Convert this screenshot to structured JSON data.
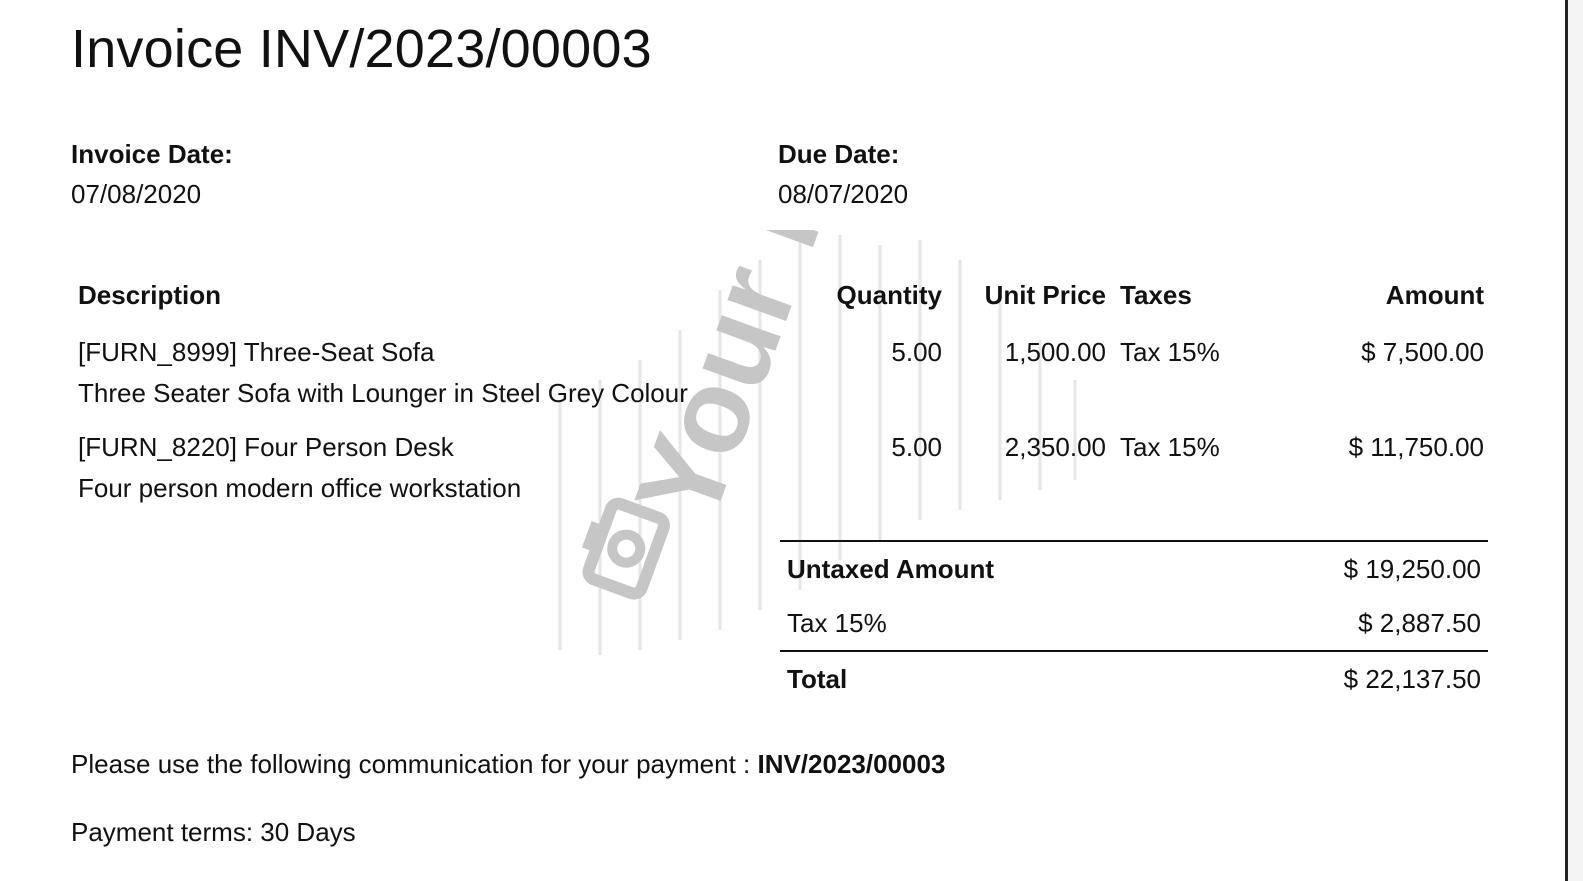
{
  "invoice": {
    "title": "Invoice INV/2023/00003",
    "invoice_date_label": "Invoice Date:",
    "invoice_date": "07/08/2020",
    "due_date_label": "Due Date:",
    "due_date": "08/07/2020"
  },
  "watermark": {
    "text": "Your logo",
    "icon": "camera-icon"
  },
  "table": {
    "headers": {
      "description": "Description",
      "quantity": "Quantity",
      "unit_price": "Unit Price",
      "taxes": "Taxes",
      "amount": "Amount"
    },
    "lines": [
      {
        "product": "[FURN_8999] Three-Seat Sofa",
        "detail": "Three Seater Sofa with Lounger in Steel Grey Colour",
        "quantity": "5.00",
        "unit_price": "1,500.00",
        "taxes": "Tax 15%",
        "amount": "$ 7,500.00"
      },
      {
        "product": "[FURN_8220] Four Person Desk",
        "detail": "Four person modern office workstation",
        "quantity": "5.00",
        "unit_price": "2,350.00",
        "taxes": "Tax 15%",
        "amount": "$ 11,750.00"
      }
    ]
  },
  "totals": {
    "untaxed_label": "Untaxed Amount",
    "untaxed_value": "$ 19,250.00",
    "tax_label": "Tax 15%",
    "tax_value": "$ 2,887.50",
    "total_label": "Total",
    "total_value": "$ 22,137.50"
  },
  "footer": {
    "communication_text": "Please use the following communication for your payment : ",
    "communication_ref": "INV/2023/00003",
    "payment_terms": "Payment terms: 30 Days"
  }
}
